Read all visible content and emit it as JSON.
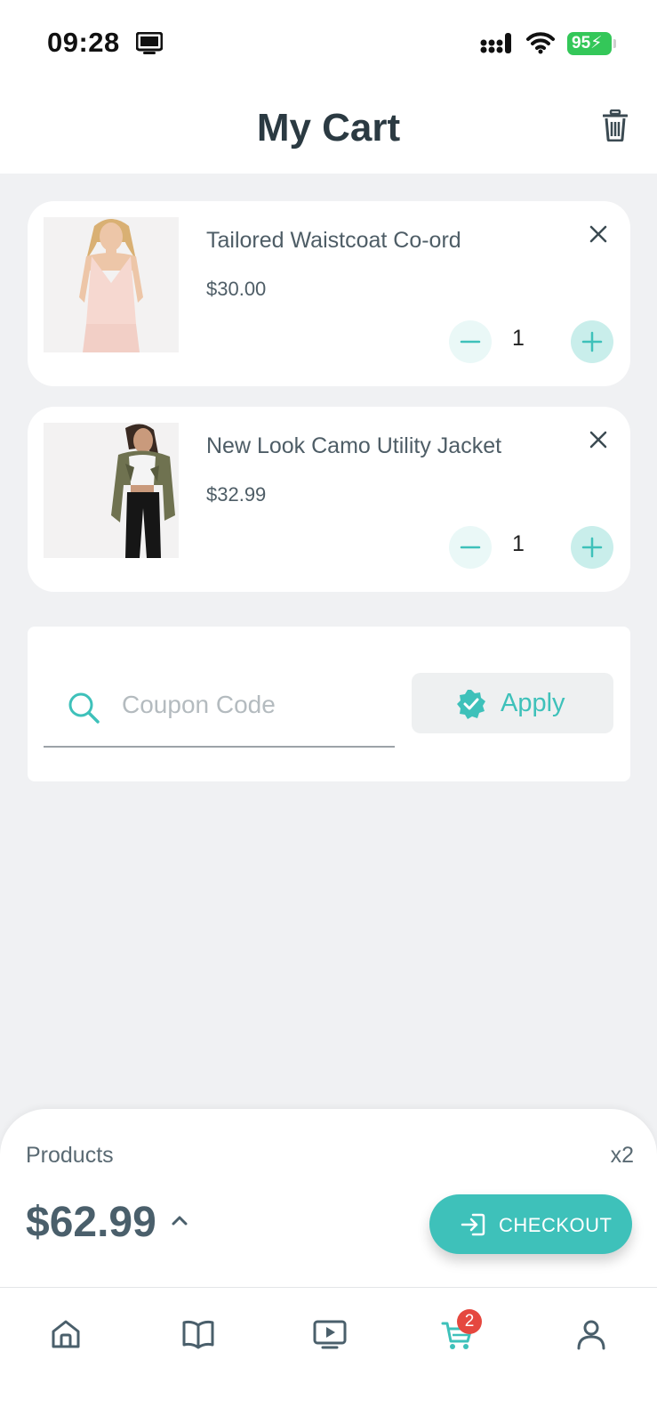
{
  "status_bar": {
    "time": "09:28",
    "battery": "95"
  },
  "header": {
    "title": "My Cart",
    "icons": {
      "clear_cart": "trash-icon"
    }
  },
  "cart": {
    "items": [
      {
        "name": "Tailored Waistcoat Co-ord",
        "price": "$30.00",
        "quantity": "1"
      },
      {
        "name": "New Look Camo Utility Jacket",
        "price": "$32.99",
        "quantity": "1"
      }
    ]
  },
  "coupon": {
    "placeholder": "Coupon Code",
    "value": "",
    "apply_label": "Apply"
  },
  "summary": {
    "products_label": "Products",
    "count": "x2",
    "total": "$62.99",
    "checkout_label": "CHECKOUT"
  },
  "bottom_nav": {
    "items": [
      "home-icon",
      "book-icon",
      "video-icon",
      "cart-icon",
      "profile-icon"
    ],
    "active": "cart-icon",
    "cart_badge": "2"
  },
  "colors": {
    "accent": "#3EC1BA",
    "background": "#F0F1F3",
    "badge": "#E5483F",
    "battery": "#34C759"
  }
}
